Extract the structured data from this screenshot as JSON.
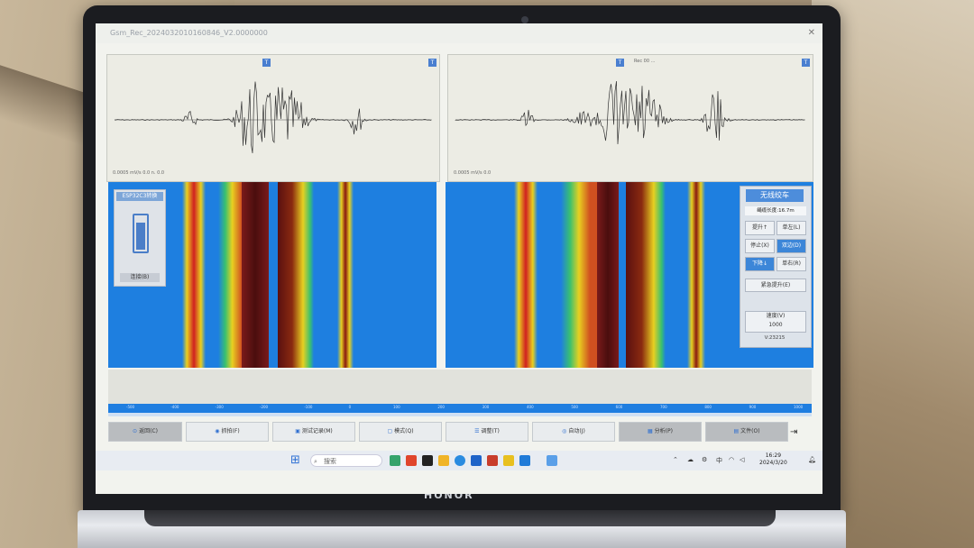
{
  "window": {
    "title": "Gsm_Rec_2024032010160846_V2.0000000"
  },
  "waveforms": {
    "left": {
      "corner": "T",
      "top_label": "",
      "bottom_label": "0.0005 mV/s 0.0\nn. 0.0"
    },
    "right": {
      "corner": "T",
      "top_label": "Rec 00 ...",
      "bottom_label": "0.0005 mV/s 0.0"
    }
  },
  "side_panel": {
    "header": "ESP32C3转换",
    "button": "连接(B)"
  },
  "control": {
    "title": "无线绞车",
    "depth": "绳缆长度:16.7m",
    "btn_up": "提升↑",
    "btn_left": "单左(L)",
    "btn_stop": "停止(X)",
    "btn_dual": "双边(D)",
    "btn_down": "下降↓",
    "btn_right": "单右(R)",
    "btn_emergency": "紧急提升(E)",
    "speed_label": "速度(V)",
    "speed_value": "1000",
    "version": "V:23215"
  },
  "axis_ticks": [
    "-500",
    "-400",
    "-300",
    "-200",
    "-100",
    "0",
    "100",
    "200",
    "300",
    "400",
    "500",
    "600",
    "700",
    "800",
    "900",
    "1000"
  ],
  "toolbar": {
    "b1": "返回(C)",
    "b2": "抓拍(F)",
    "b3": "测试记录(M)",
    "b4": "模式(Q)",
    "b5": "调整(T)",
    "b6": "自动(J)",
    "b7": "分析(P)",
    "b8": "文件(O)"
  },
  "taskbar": {
    "search": "搜索",
    "lang": "中",
    "time": "16:29",
    "date": "2024/3/20"
  },
  "laptop": {
    "brand": "HONOR"
  }
}
